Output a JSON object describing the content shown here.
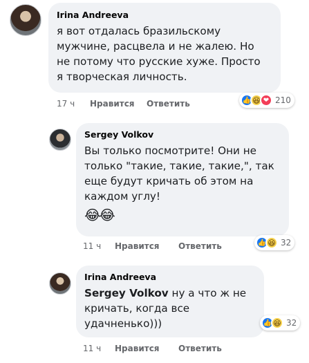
{
  "comments": [
    {
      "author": "Irina Andreeva",
      "text": "я вот отдалась бразильскому\nмужчине, расцвела и не жалею. Но\nне потому что русские хуже. Просто\nя творческая личность.",
      "time": "17 ч",
      "like_label": "Нравится",
      "reply_label": "Ответить",
      "reaction_icons": [
        "like-icon",
        "haha-icon",
        "love-icon"
      ],
      "reaction_count": "210"
    },
    {
      "author": "Sergey Volkov",
      "text": "Вы только посмотрите! Они не\nтолько \"такие, такие, такие,\", так\nеще будут кричать об этом на\nкаждом углу!",
      "emoji": "😂😂",
      "time": "11 ч",
      "like_label": "Нравится",
      "reply_label": "Ответить",
      "reaction_icons": [
        "like-icon",
        "haha-icon"
      ],
      "reaction_count": "32"
    },
    {
      "author": "Irina Andreeva",
      "mention": "Sergey Volkov",
      "text": " ну а что ж не\nкричать, когда все\nудачненько)))",
      "time": "11 ч",
      "like_label": "Нравится",
      "reply_label": "Ответить",
      "reaction_icons": [
        "like-icon",
        "haha-icon"
      ],
      "reaction_count": "32"
    }
  ],
  "colors": {
    "bubble": "#f0f2f5",
    "meta_text": "#65676b",
    "like": "#1877f2",
    "haha": "#f7d24c",
    "love": "#f33e58"
  }
}
